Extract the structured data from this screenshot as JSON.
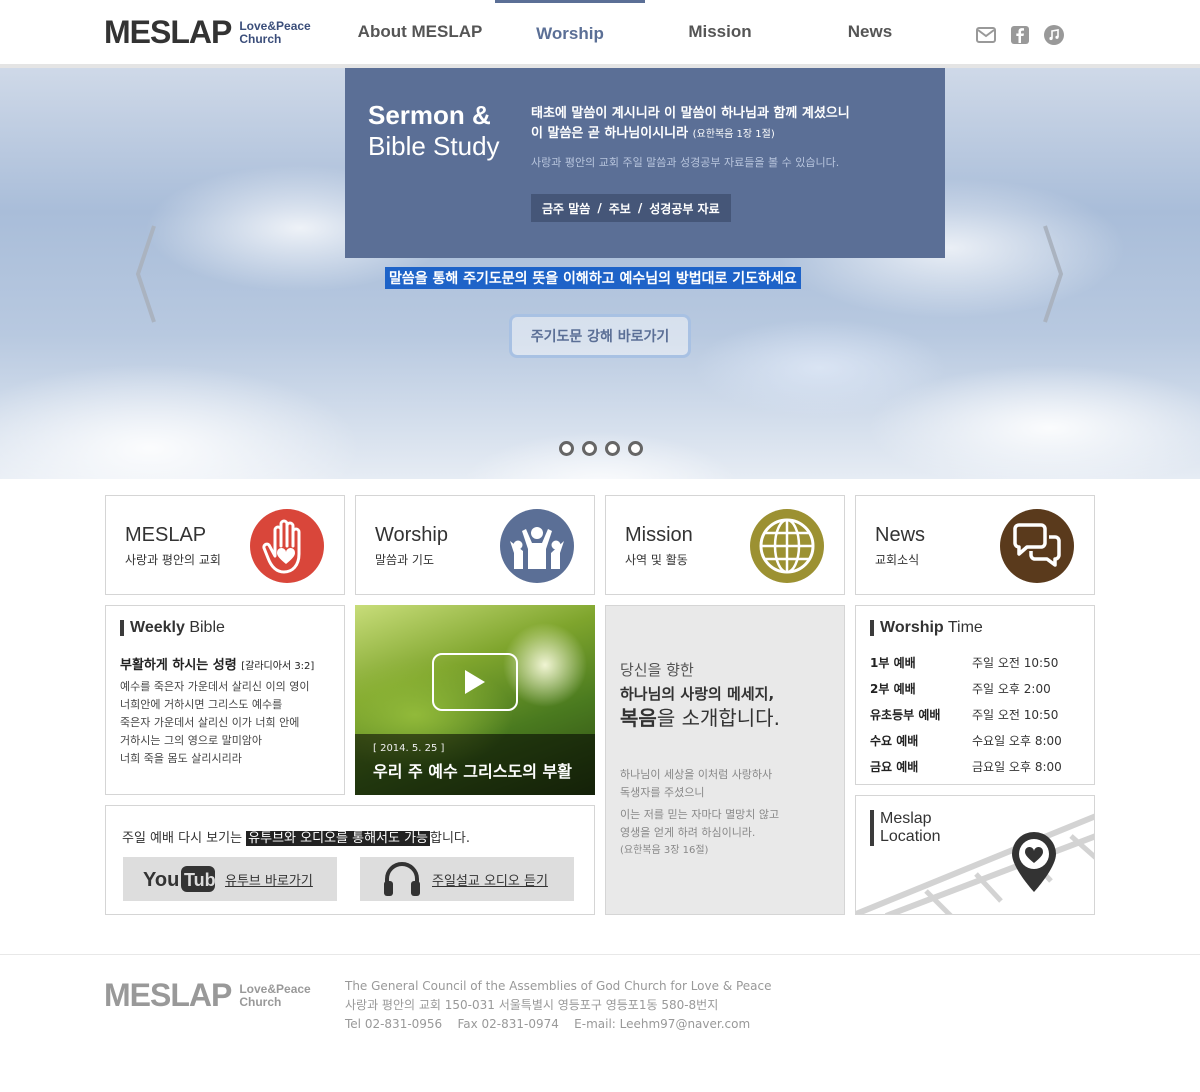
{
  "header": {
    "logo_main": "MESLAP",
    "logo_sub1": "Love&Peace",
    "logo_sub2": "Church",
    "nav": [
      "About MESLAP",
      "Worship",
      "Mission",
      "News"
    ],
    "active_nav": "Worship",
    "icons": [
      "mail-icon",
      "facebook-icon",
      "music-icon"
    ]
  },
  "hero": {
    "title_bold": "Sermon &",
    "title_light": "Bible Study",
    "verse_line1": "태초에 말씀이 계시니라 이 말씀이 하나님과 함께 계셨으니",
    "verse_line2": "이 말씀은 곧 하나님이시니라",
    "verse_ref": "(요한복음 1장 1절)",
    "description": "사랑과 평안의 교회 주일 말씀과 성경공부 자료들을 볼 수 있습니다.",
    "links": [
      "금주 말씀",
      "주보",
      "성경공부 자료"
    ],
    "link_separator": "/",
    "highlight_text": "말씀을 통해 주기도문의 뜻을 이해하고 예수님의 방법대로 기도하세요",
    "button_label": "주기도문 강해 바로가기",
    "dots": 4,
    "accent": "#5b6f96"
  },
  "quick_links": [
    {
      "title": "MESLAP",
      "subtitle": "사랑과 평안의 교회",
      "icon": "hand-heart-icon",
      "color": "#d9463a"
    },
    {
      "title": "Worship",
      "subtitle": "말씀과 기도",
      "icon": "worship-people-icon",
      "color": "#5b6f96"
    },
    {
      "title": "Mission",
      "subtitle": "사역 및 활동",
      "icon": "globe-icon",
      "color": "#9c9132"
    },
    {
      "title": "News",
      "subtitle": "교회소식",
      "icon": "chat-bubbles-icon",
      "color": "#5a3a1c"
    }
  ],
  "weekly_bible": {
    "title_bold": "Weekly",
    "title_light": "Bible",
    "verse_title": "부활하게 하시는 성령",
    "verse_ref": "[갈라디아서 3:2]",
    "lines": [
      "예수를 죽은자 가운데서 살리신 이의 영이",
      "너희안에 거하시면 그리스도 예수를",
      "죽은자 가운데서 살리신 이가 너희 안에",
      "거하시는 그의 영으로 말미암아",
      "너희 죽을 몸도 살리시리라"
    ]
  },
  "video": {
    "date": "[ 2014. 5. 25 ]",
    "title": "우리 주 예수 그리스도의 부활"
  },
  "gospel": {
    "line1": "당신을 향한",
    "line2": "하나님의 사랑의 메세지,",
    "line3_bold": "복음",
    "line3_rest": "을 소개합니다.",
    "body": [
      "하나님이 세상을 이처럼 사랑하사",
      "독생자를 주셨으니",
      "이는 저를 믿는 자마다 멸망치 않고",
      "영생을 얻게 하려 하심이니라."
    ],
    "ref": "(요한복음 3장 16절)"
  },
  "worship_time": {
    "title_bold": "Worship",
    "title_light": "Time",
    "rows": [
      {
        "name": "1부 예배",
        "time": "주일 오전 10:50"
      },
      {
        "name": "2부 예배",
        "time": "주일 오후 2:00"
      },
      {
        "name": "유초등부 예배",
        "time": "주일 오전 10:50"
      },
      {
        "name": "수요 예배",
        "time": "수요일 오후 8:00"
      },
      {
        "name": "금요 예배",
        "time": "금요일 오후 8:00"
      }
    ]
  },
  "location": {
    "title1": "Meslap",
    "title2": "Location",
    "icon": "map-pin-heart-icon"
  },
  "replay": {
    "text_before": "주일 예배 다시 보기는 ",
    "text_highlight": "유투브와 오디오를 통해서도 가능",
    "text_after": "합니다.",
    "youtube_label": "유투브 바로가기",
    "youtube_logo": "YouTube",
    "audio_label": "주일설교 오디오 듣기"
  },
  "footer": {
    "logo_main": "MESLAP",
    "logo_sub1": "Love&Peace",
    "logo_sub2": "Church",
    "line1": "The General Council of the Assemblies of God Church for Love & Peace",
    "line2": "사랑과 평안의 교회 150-031 서울특별시 영등포구 영등포1동 580-8번지",
    "line3": "Tel 02-831-0956    Fax 02-831-0974    E-mail: Leehm97@naver.com"
  }
}
